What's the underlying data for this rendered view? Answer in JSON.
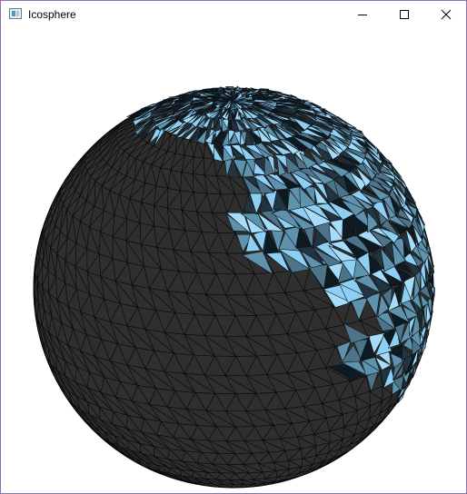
{
  "window": {
    "title": "Icosphere",
    "icon": "app-window-icon",
    "controls": [
      "minimize-icon",
      "maximize-icon",
      "close-icon"
    ]
  },
  "scene": {
    "object": "icosphere",
    "colors": {
      "base": "#2f2f2f",
      "wire": "#0a0a0a",
      "highlight_light": "#8dd0f4",
      "highlight_mid": "#5f93ad",
      "highlight_dark": "#22343f",
      "highlight_darkest": "#0e1a22",
      "background": "#ffffff"
    }
  }
}
